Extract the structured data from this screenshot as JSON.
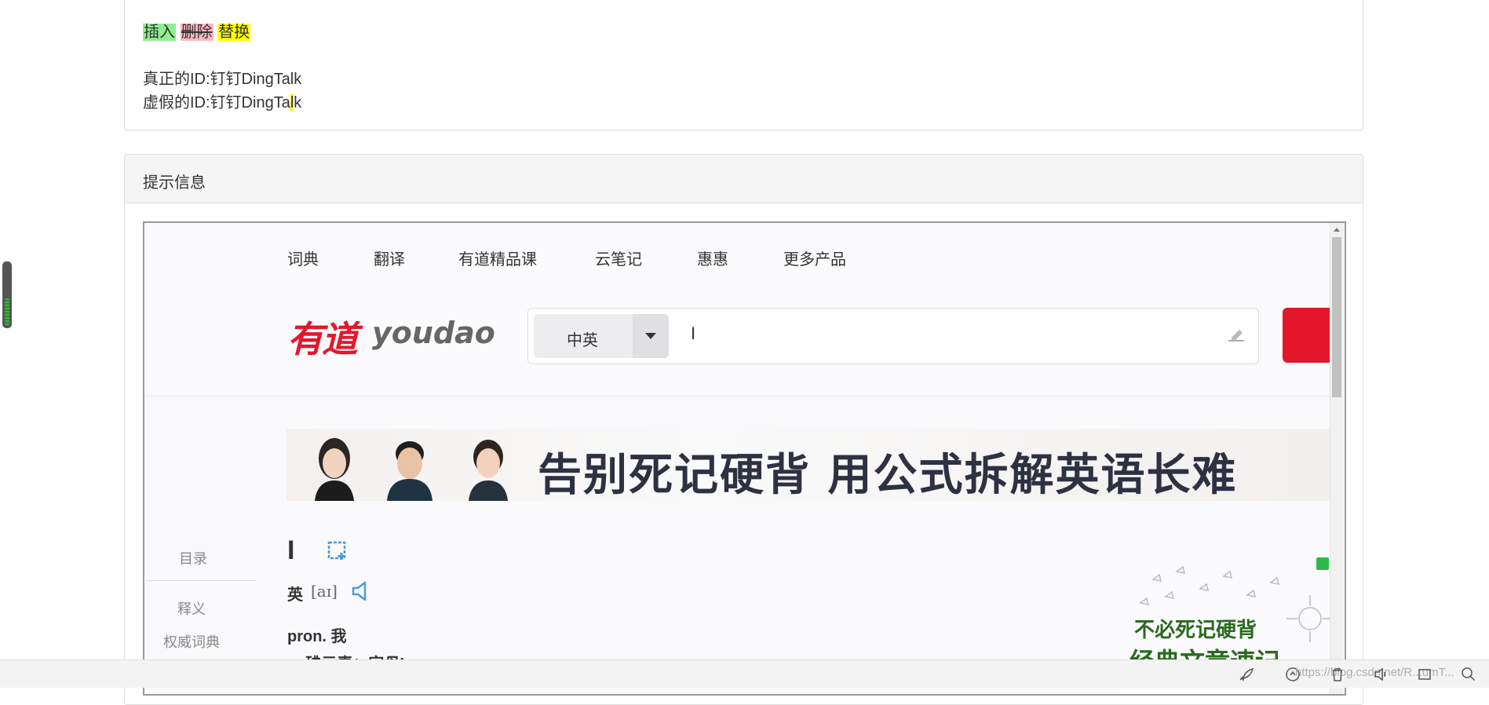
{
  "diff_legend": {
    "insert": "插入",
    "delete": "删除",
    "replace": "替换"
  },
  "ids": {
    "real_label": "真正的ID:钉钉DingTalk",
    "fake_prefix": "虚假的ID:钉钉DingTa",
    "fake_highlight": "l",
    "fake_suffix": "k"
  },
  "hint_panel": {
    "title": "提示信息"
  },
  "youdao": {
    "nav": [
      "词典",
      "翻译",
      "有道精品课",
      "云笔记",
      "惠惠",
      "更多产品"
    ],
    "logo_cn": "有道",
    "logo_en": "youdao",
    "lang_select": "中英",
    "query": "I",
    "banner_text": "告别死记硬背 用公式拆解英语长难",
    "word": "I",
    "phonetic_label": "英",
    "phonetic": "[aɪ]",
    "definition": "pron. 我",
    "definition2": "n. 碘元素；字母I",
    "toc": {
      "title": "目录",
      "items": [
        "释义",
        "权威词典"
      ]
    },
    "ad": {
      "line1": "不必死记硬背",
      "line2": "经典文章速记"
    }
  },
  "watermark": "https://blog.csdn.net/R...umT..."
}
